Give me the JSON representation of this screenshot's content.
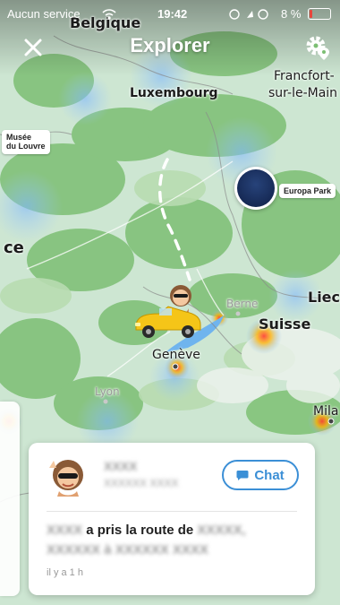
{
  "status_bar": {
    "carrier": "Aucun service",
    "time": "19:42",
    "battery": "8 %",
    "battery_color": "#e8453c"
  },
  "header": {
    "title": "Explorer",
    "close_icon": "close-icon",
    "settings_icon": "gear-location-icon"
  },
  "map": {
    "labels": {
      "belgique": "Belgique",
      "luxembourg": "Luxembourg",
      "frankfurt": "Francfort-",
      "frankfurt_2": "sur-le-Main",
      "france": "ce",
      "berne": "Berne",
      "suisse": "Suisse",
      "liech": "Liech",
      "geneve": "Genève",
      "lyon": "Lyon",
      "milan": "Mila"
    },
    "pois": {
      "louvre_1": "Musée",
      "louvre_2": "du Louvre",
      "europa_park": "Europa Park"
    }
  },
  "story_card": {
    "name": "XXXX",
    "subtitle": "XXXXXX XXXX",
    "chat_label": "Chat",
    "text_name": "XXXX",
    "text_middle": "a pris la route de",
    "text_dest": "XXXXX, XXXXXX à XXXXXX XXXX",
    "timestamp": "il y a 1 h",
    "accent": "#3b8fd6"
  }
}
